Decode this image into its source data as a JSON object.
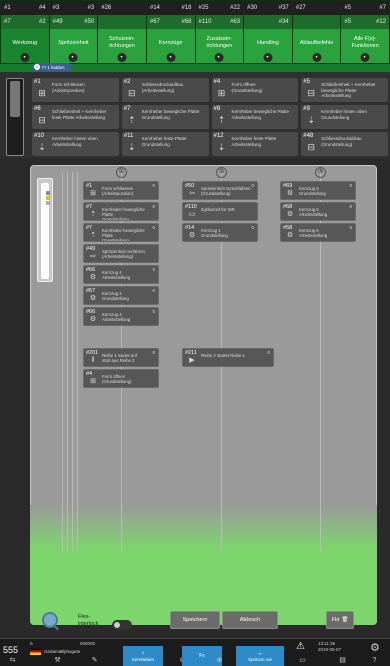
{
  "tabs": [
    {
      "top": [
        "#1",
        "#4"
      ],
      "sub": [
        "#7",
        "#2"
      ],
      "label": [
        "Werkzeug"
      ],
      "active": true
    },
    {
      "top": [
        "#3",
        "#3"
      ],
      "sub": [
        "#49",
        "#50"
      ],
      "label": [
        "Spritzeinheit"
      ]
    },
    {
      "top": [
        "#26",
        ""
      ],
      "sub": [
        "",
        ""
      ],
      "label": [
        "Schutzein-",
        "richtungen"
      ]
    },
    {
      "top": [
        "#14",
        "#18"
      ],
      "sub": [
        "#67",
        "#68"
      ],
      "label": [
        "Kernzüge"
      ]
    },
    {
      "top": [
        "#25",
        "#22"
      ],
      "sub": [
        "#110",
        "#63"
      ],
      "label": [
        "Zusatzein-",
        "richtungen"
      ]
    },
    {
      "top": [
        "#30",
        "#37"
      ],
      "sub": [
        "",
        "#34"
      ],
      "label": [
        "Handling"
      ]
    },
    {
      "top": [
        "#27",
        ""
      ],
      "sub": [
        "",
        ""
      ],
      "label": [
        "Ablaufbefehle"
      ]
    },
    {
      "top": [
        "#5",
        "#7"
      ],
      "sub": [
        "#5",
        "#12"
      ],
      "label": [
        "Alle F(x)-",
        "Funktionen"
      ]
    }
  ],
  "flow_pill": {
    "num": "0",
    "label": "FI 1 hidden"
  },
  "palette": [
    {
      "num": "#1",
      "icon": "⊞",
      "text": [
        "Form schliessen",
        "(Arbeitsposition)"
      ]
    },
    {
      "num": "#2",
      "icon": "⊟",
      "text": [
        "Schliessdruckaufbau",
        "(Arbeitsstellung)"
      ]
    },
    {
      "num": "#4",
      "icon": "⊞",
      "text": [
        "Form öffnen",
        "(Grundstellung)"
      ]
    },
    {
      "num": "#5",
      "icon": "⊟",
      "text": [
        "Schließeinheit + Kernheber",
        "bewegliche Platte",
        "Arbeitsstellung"
      ]
    },
    {
      "num": "#6",
      "icon": "⊟",
      "text": [
        "Schließeinheit + Kernheber",
        "feste Platte Arbeitsstellung"
      ]
    },
    {
      "num": "#7",
      "icon": "⇡",
      "text": [
        "Kernheber bewegliche Platte",
        "Grundstellung"
      ]
    },
    {
      "num": "#8",
      "icon": "⇡",
      "text": [
        "Kernheber bewegliche Platte",
        "Arbeitsstellung"
      ]
    },
    {
      "num": "#9",
      "icon": "⇣",
      "text": [
        "Kernheber hinten oben",
        "Grundstellung"
      ]
    },
    {
      "num": "#10",
      "icon": "⇣",
      "text": [
        "Kernheber hinten oben",
        "Arbeitsstellung"
      ]
    },
    {
      "num": "#11",
      "icon": "⇣",
      "text": [
        "Kernheber feste Platte",
        "Grundstellung"
      ]
    },
    {
      "num": "#12",
      "icon": "⇣",
      "text": [
        "Kernheber feste Platte",
        "Arbeitsstellung"
      ]
    },
    {
      "num": "#48",
      "icon": "⊟",
      "text": [
        "Schliessdruckabbau",
        "(Grundstellung)"
      ]
    }
  ],
  "columns": [
    "①",
    "②",
    "③"
  ],
  "steps": {
    "col1": [
      {
        "num": "#1",
        "icon": "⊞",
        "text": [
          "Form schliessen",
          "(Arbeitsposition)"
        ],
        "badge": "0"
      },
      {
        "num": "#7",
        "icon": "⇡",
        "text": [
          "Kernheber bewegliche Platte",
          "Grundstellung"
        ],
        "badge": "0"
      },
      {
        "num": "#7",
        "icon": "⇡",
        "text": [
          "Kernheber bewegliche Platte",
          "Grundstellung"
        ],
        "badge": "0"
      },
      {
        "num": "#49",
        "icon": "⇨",
        "text": [
          "Spritzeinheit vorfahren",
          "(Arbeitsstellung)"
        ],
        "badge": ""
      },
      {
        "num": "#66",
        "icon": "⚙",
        "text": [
          "Kernzug 4",
          "Arbeitsstellung"
        ],
        "badge": "0"
      },
      {
        "num": "#67",
        "icon": "⚙",
        "text": [
          "Kernzug 4",
          "Grundstellung"
        ],
        "badge": "0"
      },
      {
        "num": "#66",
        "icon": "⚙",
        "text": [
          "Kernzug 4",
          "Arbeitsstellung"
        ],
        "badge": "0"
      },
      {
        "num": "#201",
        "icon": "‖",
        "text": [
          "Reihe 1 wartet auf",
          "start aus Reihe 2"
        ],
        "badge": "0"
      },
      {
        "num": "#4",
        "icon": "⊞",
        "text": [
          "Form öffnen",
          "(Grundstellung)"
        ],
        "badge": ""
      }
    ],
    "col2": [
      {
        "num": "#50",
        "icon": "⇦",
        "text": [
          "Spritzeinheit zurückfahren",
          "(Grundstellung)"
        ],
        "badge": "0"
      },
      {
        "num": "#110",
        "icon": "▭",
        "text": [
          "Zykluszeit für IDR"
        ],
        "badge": ""
      },
      {
        "num": "#14",
        "icon": "⚙",
        "text": [
          "Kernzug 1",
          "Grundstellung"
        ],
        "badge": "0"
      }
    ],
    "col2_link": {
      "num": "#211",
      "icon": "▶",
      "text": [
        "Reihe 2 startet Reihe 1"
      ],
      "badge": "0"
    },
    "col3": [
      {
        "num": "#69",
        "icon": "⚙",
        "text": [
          "Kernzug 5",
          "Grundstellung"
        ],
        "badge": "0"
      },
      {
        "num": "#68",
        "icon": "⚙",
        "text": [
          "Kernzug 5",
          "Arbeitsstellung"
        ],
        "badge": "0"
      },
      {
        "num": "#58",
        "icon": "⚙",
        "text": [
          "Kernzug 5",
          "Arbeitsstellung"
        ],
        "badge": "0"
      }
    ]
  },
  "editor": {
    "flex_label": [
      "Flex-",
      "interlock"
    ],
    "save": "Speichern",
    "cancel": "Abbruch",
    "fkt": "Fkt"
  },
  "status": {
    "counter": "555",
    "small1": "0",
    "small2": "Gedamer",
    "small3": "Alphagate",
    "val": "000000",
    "time": "13:11:36",
    "date": "2019-05-07",
    "tab_kernheben": "Kernheben",
    "tab_fx": "Fx",
    "tab_spritzen": "Spritzen vor",
    "colors": {
      "active": "#2f8bc7",
      "green": "#2aa33f"
    }
  }
}
